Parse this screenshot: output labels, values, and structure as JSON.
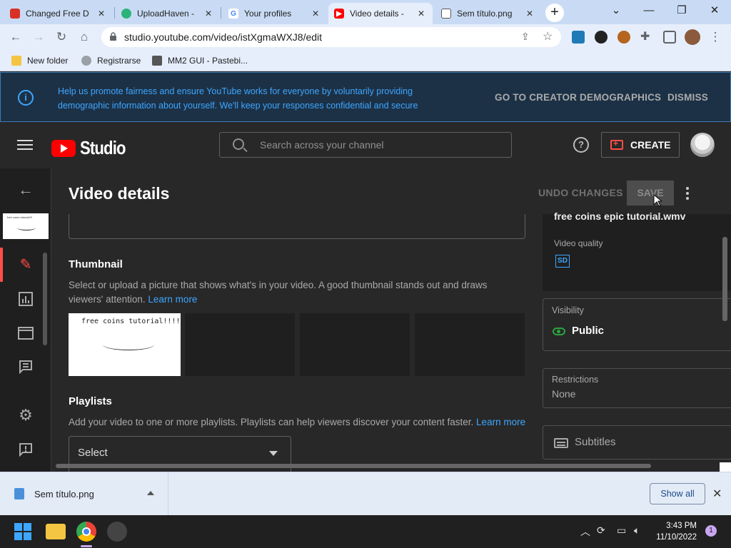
{
  "browser": {
    "tabs": [
      {
        "title": "Changed Free D",
        "icon": "red-icon",
        "color": "#d93025"
      },
      {
        "title": "UploadHaven -",
        "icon": "uploadhaven-icon",
        "color": "#2bb37a"
      },
      {
        "title": "Your profiles",
        "icon": "google-icon",
        "color": "#4285f4"
      },
      {
        "title": "Video details -",
        "icon": "youtube-icon",
        "color": "#ff0000"
      },
      {
        "title": "Sem título.png",
        "icon": "image-icon",
        "color": "#555555"
      }
    ],
    "tab_close": "✕",
    "new_tab": "+",
    "window_controls": {
      "chevron": "⌄",
      "minimize": "—",
      "restore": "❐",
      "close": "✕"
    },
    "url": "studio.youtube.com/video/istXgmaWXJ8/edit",
    "bookmarks": [
      {
        "label": "New folder",
        "icon": "folder-icon"
      },
      {
        "label": "Registrarse",
        "icon": "globe-icon"
      },
      {
        "label": "MM2 GUI - Pastebi...",
        "icon": "pastebin-icon"
      }
    ]
  },
  "banner": {
    "info_glyph": "i",
    "message": "Help us promote fairness and ensure YouTube works for everyone by voluntarily providing demographic information about yourself. We'll keep your responses confidential and secure",
    "link_demographics": "GO TO CREATOR DEMOGRAPHICS",
    "link_dismiss": "DISMISS"
  },
  "header": {
    "logo_text": "Studio",
    "search_placeholder": "Search across your channel",
    "help_glyph": "?",
    "create_label": "CREATE"
  },
  "rail": {
    "back": "←"
  },
  "page": {
    "title": "Video details",
    "undo": "UNDO CHANGES",
    "save": "SAVE",
    "thumbnail_heading": "Thumbnail",
    "thumbnail_desc": "Select or upload a picture that shows what's in your video. A good thumbnail stands out and draws viewers' attention.",
    "learn_more": "Learn more",
    "thumbnail_text": "free coins tutorial!!!!",
    "playlists_heading": "Playlists",
    "playlists_desc": "Add your video to one or more playlists. Playlists can help viewers discover your content faster.",
    "select_label": "Select"
  },
  "side_panel": {
    "filename": "free coins epic tutorial.wmv",
    "video_quality_label": "Video quality",
    "quality_badge": "SD",
    "visibility_label": "Visibility",
    "visibility_value": "Public",
    "restrictions_label": "Restrictions",
    "restrictions_value": "None",
    "subtitles_label": "Subtitles"
  },
  "downloads": {
    "file": "Sem título.png",
    "show_all": "Show all",
    "close": "✕"
  },
  "taskbar": {
    "time": "3:43 PM",
    "date": "11/10/2022",
    "notifications": "1"
  }
}
